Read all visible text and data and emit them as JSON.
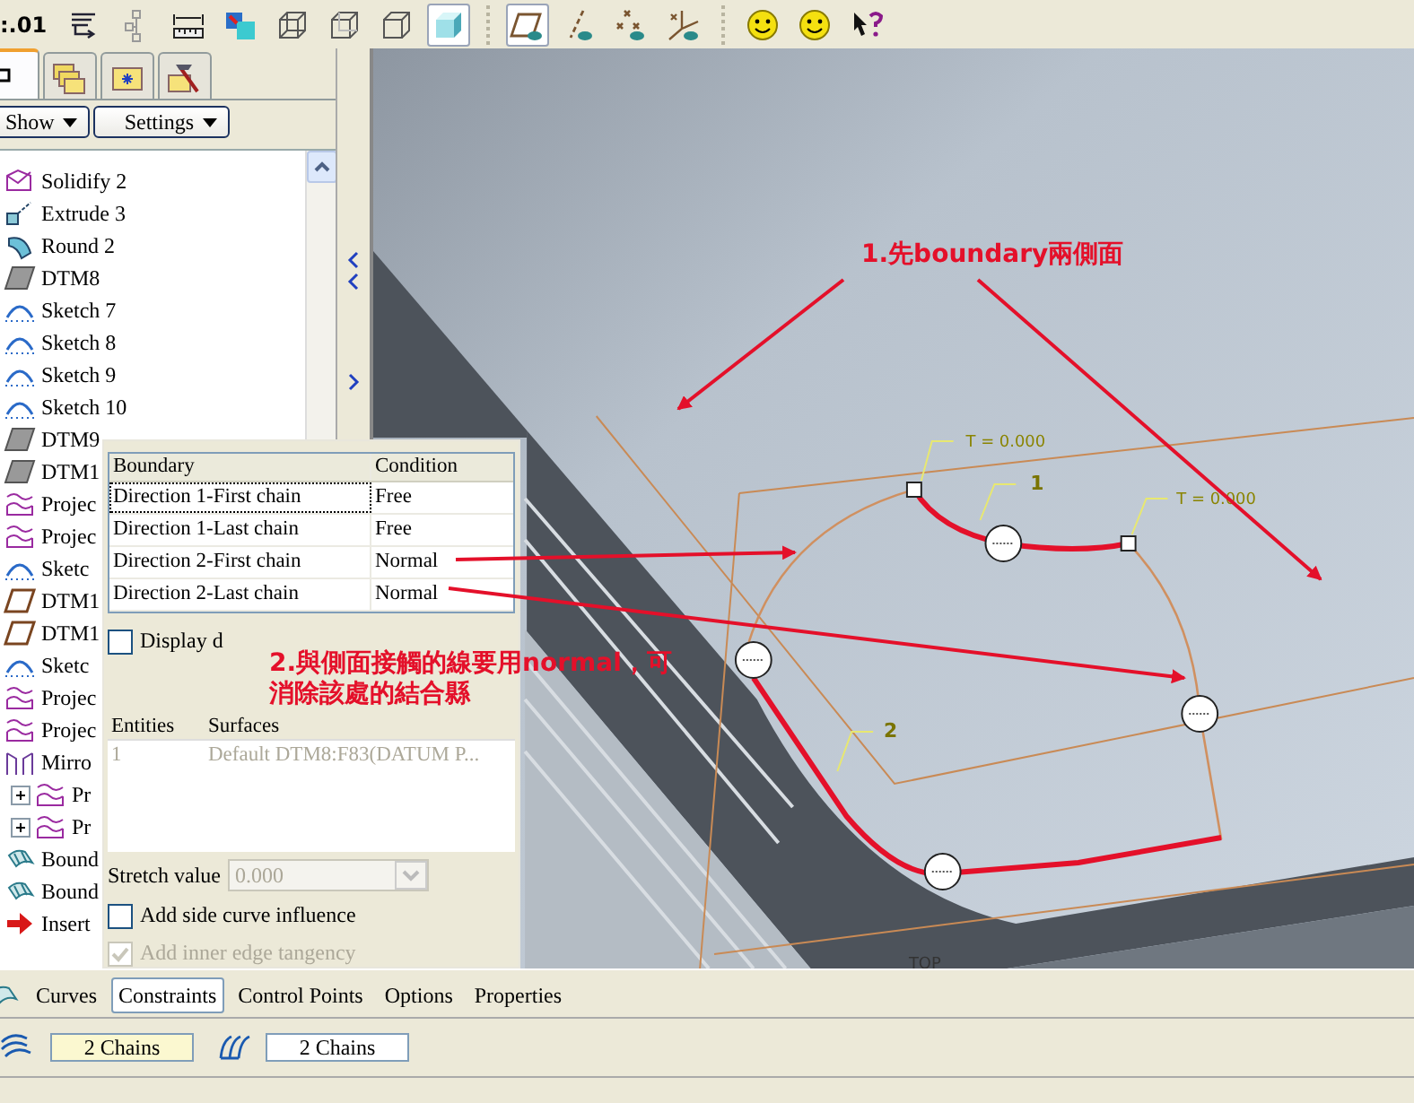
{
  "toolbar": {
    "label": ":.01",
    "groups": [
      [
        {
          "kind": "regen",
          "pressed": false
        },
        {
          "kind": "tree",
          "pressed": false
        },
        {
          "kind": "measure",
          "pressed": false
        },
        {
          "kind": "analysis",
          "pressed": false
        },
        {
          "kind": "wireframe",
          "pressed": false
        },
        {
          "kind": "hidden",
          "pressed": false
        },
        {
          "kind": "nohidden",
          "pressed": false
        },
        {
          "kind": "shaded",
          "pressed": true
        }
      ],
      [
        {
          "kind": "planes",
          "pressed": true
        },
        {
          "kind": "axes",
          "pressed": false
        },
        {
          "kind": "points",
          "pressed": false
        },
        {
          "kind": "csys",
          "pressed": false
        }
      ],
      [
        {
          "kind": "smiley",
          "pressed": false
        },
        {
          "kind": "smiley",
          "pressed": false
        },
        {
          "kind": "help",
          "pressed": false
        }
      ]
    ]
  },
  "navigator": {
    "tabs": [
      {
        "kind": "model_tree",
        "selected": true
      },
      {
        "kind": "folders",
        "selected": false
      },
      {
        "kind": "favorites",
        "selected": false
      },
      {
        "kind": "tools",
        "selected": false
      }
    ],
    "menus": [
      "Show",
      "Settings"
    ],
    "tree": [
      {
        "label": "Solidify 2",
        "kind": "solidify"
      },
      {
        "label": "Extrude 3",
        "kind": "extrude"
      },
      {
        "label": "Round 2",
        "kind": "round"
      },
      {
        "label": "DTM8",
        "kind": "datum"
      },
      {
        "label": "Sketch 7",
        "kind": "sketch"
      },
      {
        "label": "Sketch 8",
        "kind": "sketch"
      },
      {
        "label": "Sketch 9",
        "kind": "sketch"
      },
      {
        "label": "Sketch 10",
        "kind": "sketch"
      },
      {
        "label": "DTM9",
        "kind": "datum"
      },
      {
        "label": "DTM1",
        "kind": "datum"
      },
      {
        "label": "Projec",
        "kind": "projected"
      },
      {
        "label": "Projec",
        "kind": "projected"
      },
      {
        "label": "Sketc",
        "kind": "sketch"
      },
      {
        "label": "DTM1",
        "kind": "plane"
      },
      {
        "label": "DTM1",
        "kind": "plane"
      },
      {
        "label": "Sketc",
        "kind": "sketch"
      },
      {
        "label": "Projec",
        "kind": "projected"
      },
      {
        "label": "Projec",
        "kind": "projected"
      },
      {
        "label": "Mirro",
        "kind": "mirror",
        "children": [
          {
            "label": "Pr",
            "kind": "projected",
            "collapsed": true
          },
          {
            "label": "Pr",
            "kind": "projected",
            "collapsed": true
          }
        ]
      },
      {
        "label": "Bound",
        "kind": "boundary"
      },
      {
        "label": "Bound",
        "kind": "boundary"
      },
      {
        "label": "Insert",
        "kind": "insert"
      }
    ]
  },
  "viewport": {
    "callouts": [
      {
        "kind": "tension",
        "text": "T = 0.000"
      },
      {
        "kind": "curve",
        "text": "1"
      },
      {
        "kind": "tension",
        "text": "T = 0.000"
      },
      {
        "kind": "curve",
        "text": "2"
      }
    ],
    "view_label": "TOP"
  },
  "annotations": [
    {
      "lines": [
        "1.先boundary兩側面"
      ]
    },
    {
      "lines": [
        "2.與側面接觸的線要用normal，可",
        "消除該處的結合縣"
      ]
    }
  ],
  "constraints_panel": {
    "columns": [
      "Boundary",
      "Condition"
    ],
    "rows": [
      {
        "boundary": "Direction 1-First chain",
        "condition": "Free",
        "selected": true
      },
      {
        "boundary": "Direction 1-Last chain",
        "condition": "Free",
        "selected": false
      },
      {
        "boundary": "Direction 2-First chain",
        "condition": "Normal",
        "selected": false
      },
      {
        "boundary": "Direction 2-Last chain",
        "condition": "Normal",
        "selected": false
      }
    ],
    "display_checkbox": {
      "label": "Display d",
      "checked": false
    },
    "entities": {
      "columns": [
        "Entities",
        "Surfaces"
      ],
      "rows": [
        {
          "index": "1",
          "surface": "Default DTM8:F83(DATUM P..."
        }
      ],
      "disabled": true
    },
    "stretch": {
      "label": "Stretch value",
      "value": "0.000",
      "disabled": true
    },
    "options": [
      {
        "label": "Add side curve influence",
        "checked": false,
        "disabled": false
      },
      {
        "label": "Add inner edge tangency",
        "checked": true,
        "disabled": true
      }
    ]
  },
  "dashboard": {
    "tabs": [
      {
        "label": "Curves",
        "selected": false
      },
      {
        "label": "Constraints",
        "selected": true
      },
      {
        "label": "Control Points",
        "selected": false
      },
      {
        "label": "Options",
        "selected": false
      },
      {
        "label": "Properties",
        "selected": false
      }
    ],
    "collectors": [
      {
        "kind": "first_direction",
        "value": "2 Chains",
        "active": true
      },
      {
        "kind": "second_direction",
        "value": "2 Chains",
        "active": false
      }
    ]
  }
}
